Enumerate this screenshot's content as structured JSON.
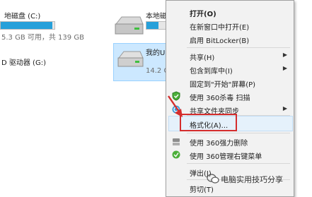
{
  "explorer": {
    "drive_c": {
      "label": "地磁盘 (C:)",
      "info": "5.3 GB 可用，共 139 GB",
      "used_fraction": 0.96
    },
    "drive_d": {
      "label": "本地磁",
      "used_fraction": 0.55
    },
    "drive_g": {
      "label": "D 驱动器 (G:)"
    },
    "usb": {
      "label": "我的U",
      "info": "14.2 G"
    }
  },
  "context_menu": {
    "items": [
      {
        "label": "打开(O)",
        "bold": true
      },
      {
        "label": "在新窗口中打开(E)"
      },
      {
        "label": "启用 BitLocker(B)"
      },
      {
        "label": "共享(H)",
        "submenu": true
      },
      {
        "label": "包含到库中(I)",
        "submenu": true
      },
      {
        "label": "固定到\"开始\"屏幕(P)"
      },
      {
        "label": "使用 360杀毒 扫描",
        "icon": "360-shield-icon"
      },
      {
        "label": "共享文件夹同步",
        "icon": "sync-icon",
        "submenu": true
      },
      {
        "label": "格式化(A)...",
        "highlighted": true
      },
      {
        "label": "使用 360强力删除",
        "icon": "shredder-icon"
      },
      {
        "label": "使用 360管理右键菜单",
        "icon": "360-menu-icon"
      },
      {
        "label": "弹出(J)"
      },
      {
        "label": "剪切(T)"
      }
    ]
  },
  "annotation": {
    "color": "#d42d2d"
  },
  "watermark": {
    "text": "电脑实用技巧分享"
  }
}
